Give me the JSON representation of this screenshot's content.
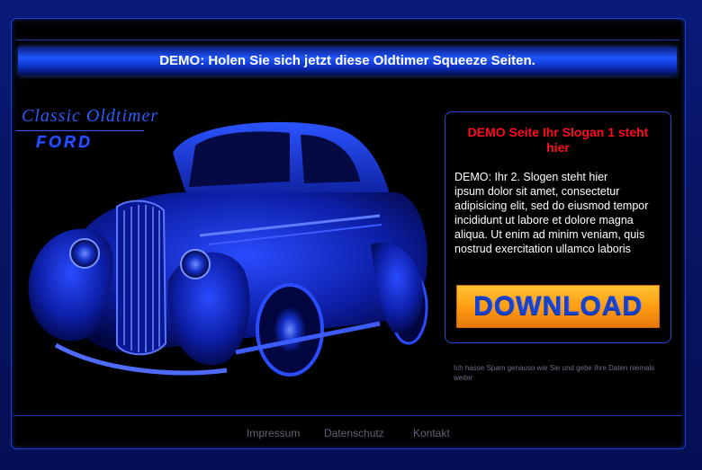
{
  "banner": {
    "text": "DEMO: Holen Sie sich jetzt diese Oldtimer Squeeze Seiten."
  },
  "logo": {
    "script_text": "Classic Oldtimer",
    "brand_text": "FORD"
  },
  "panel": {
    "slogan": "DEMO Seite Ihr Slogan 1 steht hier",
    "line1": "DEMO: Ihr 2. Slogen steht hier",
    "body": "ipsum dolor sit amet, consectetur adipisicing elit, sed do eiusmod tempor incididunt ut labore et dolore magna aliqua. Ut enim ad minim veniam, quis nostrud exercitation ullamco laboris",
    "download_label": "DOWNLOAD"
  },
  "spam_note": "Ich hasse Spam genauso wie Sie und gebe Ihre Daten niemals weiter",
  "footer": {
    "links": [
      "Impressum",
      "Datenschutz",
      "Kontakt"
    ]
  },
  "colors": {
    "accent_blue": "#1f55ff",
    "slogan_red": "#ff0b1f",
    "button_orange": "#ff9a10",
    "button_text": "#1842c8"
  },
  "icons": {
    "car_image": "vintage-car-illustration"
  }
}
